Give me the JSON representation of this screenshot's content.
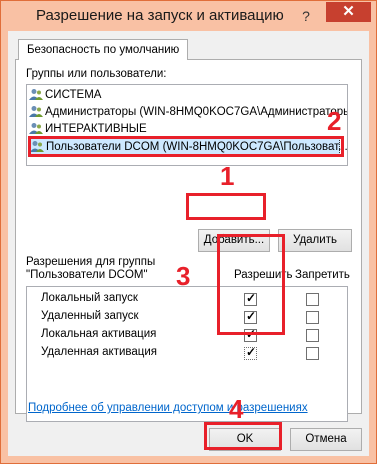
{
  "window": {
    "title": "Разрешение на запуск и активацию",
    "help_label": "?",
    "close_label": "✕"
  },
  "tab": {
    "label": "Безопасность по умолчанию"
  },
  "groups": {
    "label": "Группы или пользователи:",
    "items": [
      {
        "label": "СИСТЕМА",
        "icon": "users-icon"
      },
      {
        "label": "Администраторы (WIN-8HMQ0KOC7GA\\Администраторы)",
        "icon": "users-icon"
      },
      {
        "label": "ИНТЕРАКТИВНЫЕ",
        "icon": "users-icon"
      },
      {
        "label": "Пользователи DCOM (WIN-8HMQ0KOC7GA\\Пользоват...",
        "icon": "users-icon",
        "selected": true
      }
    ]
  },
  "buttons": {
    "add": "Добавить...",
    "remove": "Удалить",
    "ok": "OK",
    "cancel": "Отмена"
  },
  "permissions": {
    "label_line1": "Разрешения для группы",
    "label_line2": "\"Пользователи DCOM\"",
    "allow_header": "Разрешить",
    "deny_header": "Запретить",
    "rows": [
      {
        "name": "Локальный запуск",
        "allow": true,
        "deny": false
      },
      {
        "name": "Удаленный запуск",
        "allow": true,
        "deny": false
      },
      {
        "name": "Локальная активация",
        "allow": true,
        "deny": false
      },
      {
        "name": "Удаленная активация",
        "allow": true,
        "deny": false
      }
    ]
  },
  "link": {
    "label": "Подробнее об управлении доступом и разрешениях"
  },
  "annotations": {
    "badge1": "1",
    "badge2": "2",
    "badge3": "3",
    "badge4": "4",
    "color": "#e8202a"
  },
  "colors": {
    "title_bar": "#f9c1a4",
    "close_button": "#c7402f",
    "selection": "#cde8ff",
    "link": "#0066cc"
  }
}
